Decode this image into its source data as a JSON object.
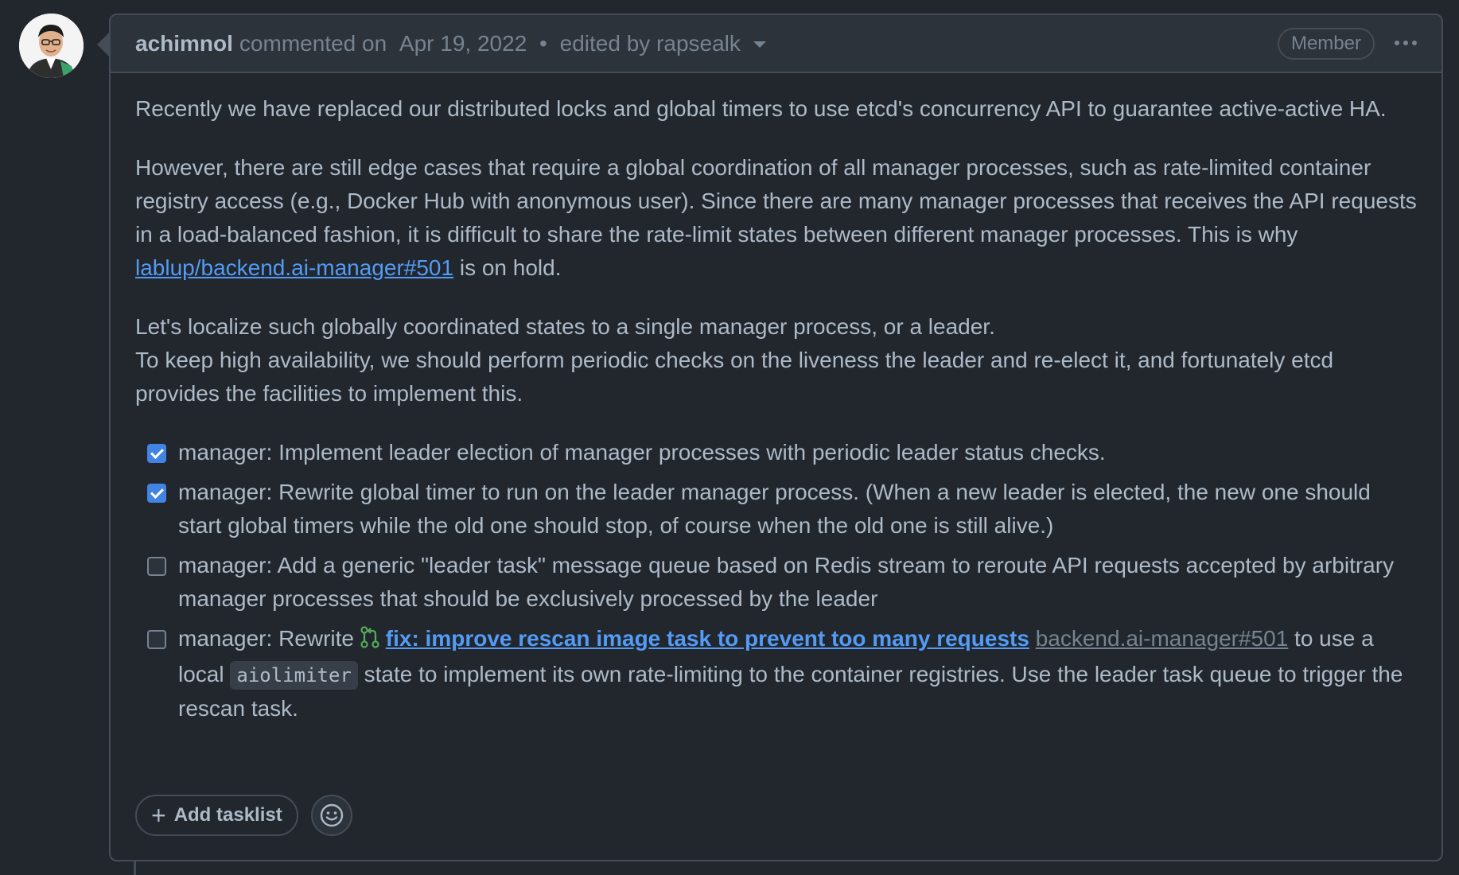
{
  "header": {
    "author": "achimnol",
    "action": "commented on",
    "date": "Apr 19, 2022",
    "separator": "•",
    "edited_by": "edited by rapsealk",
    "badge": "Member",
    "more_icon": "kebab-horizontal-icon"
  },
  "body": {
    "p1": "Recently we have replaced our distributed locks and global timers to use etcd's concurrency API to guarantee active-active HA.",
    "p2_text": "However, there are still edge cases that require a global coordination of all manager processes, such as rate-limited container registry access (e.g., Docker Hub with anonymous user). Since there are many manager processes that receives the API requests in a load-balanced fashion, it is difficult to share the rate-limit states between different manager processes. This is why ",
    "p2_link": "lablup/backend.ai-manager#501",
    "p2_tail": " is on hold.",
    "p3_line1": "Let's localize such globally coordinated states to a single manager process, or a leader.",
    "p3_line2": "To keep high availability, we should perform periodic checks on the liveness the leader and re-elect it, and fortunately etcd provides the facilities to implement this."
  },
  "tasks": [
    {
      "checked": true,
      "text": "manager: Implement leader election of manager processes with periodic leader status checks."
    },
    {
      "checked": true,
      "text": "manager: Rewrite global timer to run on the leader manager process. (When a new leader is elected, the new one should start global timers while the old one should stop, of course when the old one is still alive.)"
    },
    {
      "checked": false,
      "text": "manager: Add a generic \"leader task\" message queue based on Redis stream to reroute API requests accepted by arbitrary manager processes that should be exclusively processed by the leader"
    },
    {
      "checked": false,
      "prefix": "manager: Rewrite ",
      "pr_title": "fix: improve rescan image task to prevent too many requests",
      "pr_ref": "backend.ai-manager#501",
      "middle": " to use a local ",
      "code": "aiolimiter",
      "suffix": " state to implement its own rate-limiting to the container registries. Use the leader task queue to trigger the rescan task."
    }
  ],
  "actions": {
    "add_tasklist": "Add tasklist",
    "plus_icon": "plus-icon",
    "emoji_icon": "smiley-icon"
  },
  "colors": {
    "background": "#22272e",
    "header_bg": "#2d333b",
    "border": "#444c56",
    "link": "#539bf5",
    "checkbox_checked": "#4184e4",
    "pr_open_icon": "#57ab5a"
  }
}
